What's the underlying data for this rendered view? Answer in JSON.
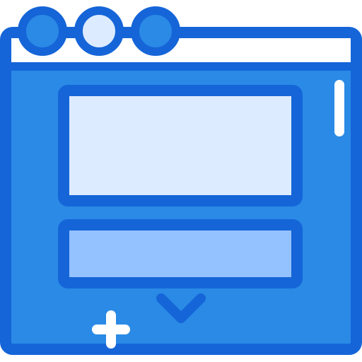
{
  "icon": {
    "name": "browser-window-icon",
    "parts": {
      "window": "browser-window",
      "title_bar": "title-bar",
      "window_controls": [
        "window-control-1",
        "window-control-2",
        "window-control-3"
      ],
      "scrollbar": "scrollbar",
      "content_block_top": "content-block-top",
      "content_block_bottom": "content-block-bottom",
      "scroll_down": "chevron-down-icon",
      "add": "plus-icon"
    }
  },
  "colors": {
    "outline": "#1565D8",
    "window_fill": "#2A8AE6",
    "title_bar_fill": "#FFFFFF",
    "control_fill_dark": "#2A8AE6",
    "control_fill_light": "#DCEBFF",
    "block_top_fill": "#DCEBFF",
    "block_bottom_fill": "#94C1FF",
    "accent_white": "#FFFFFF"
  }
}
